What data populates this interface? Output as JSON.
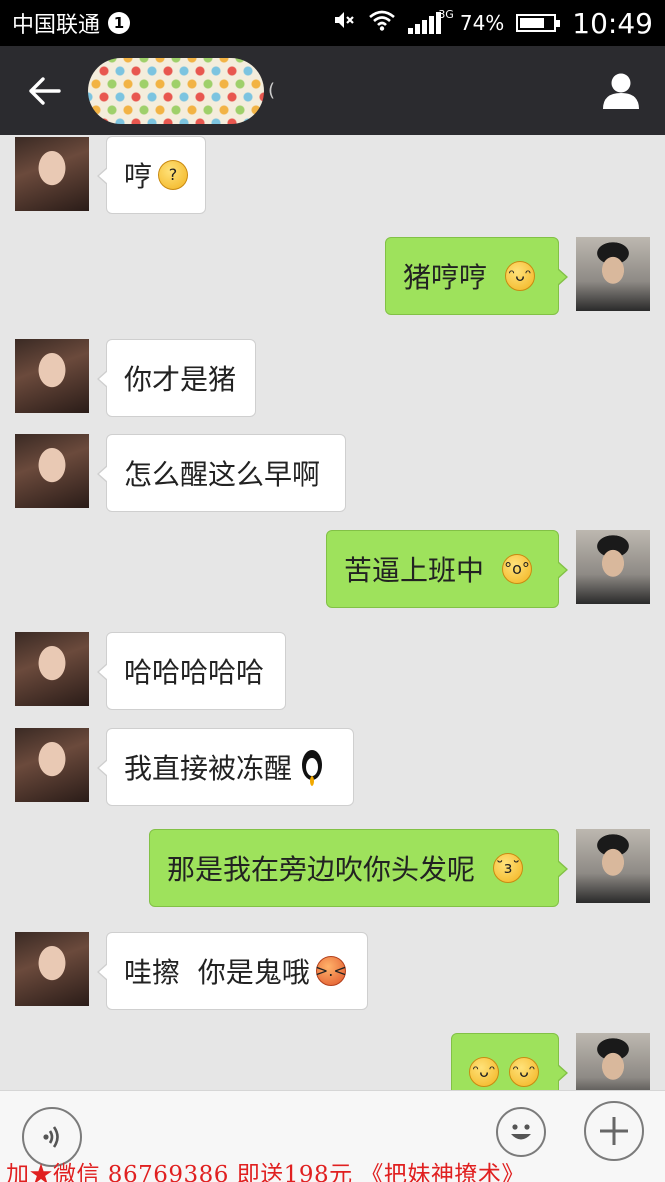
{
  "status_bar": {
    "carrier": "中国联通",
    "notification_count": "1",
    "network_type": "3G",
    "battery": "74%",
    "time": "10:49"
  },
  "title_bar": {
    "back_icon": "arrow-left-icon",
    "contact_name_obscured": true,
    "profile_icon": "person-icon"
  },
  "messages": [
    {
      "side": "in",
      "text": "哼",
      "emoji": [
        "confused"
      ]
    },
    {
      "side": "out",
      "text": "猪哼哼",
      "emoji": [
        "grin"
      ]
    },
    {
      "side": "in",
      "text": "你才是猪",
      "emoji": []
    },
    {
      "side": "in",
      "text": "怎么醒这么早啊",
      "emoji": []
    },
    {
      "side": "out",
      "text": "苦逼上班中",
      "emoji": [
        "shocked"
      ]
    },
    {
      "side": "in",
      "text": "哈哈哈哈哈",
      "emoji": []
    },
    {
      "side": "in",
      "text": "我直接被冻醒",
      "emoji": [
        "qq-penguin"
      ]
    },
    {
      "side": "out",
      "text": "那是我在旁边吹你头发呢",
      "emoji": [
        "kiss"
      ]
    },
    {
      "side": "in",
      "text": "哇擦  你是鬼哦",
      "emoji": [
        "angry"
      ]
    },
    {
      "side": "out",
      "text": "",
      "emoji": [
        "grin",
        "grin"
      ]
    }
  ],
  "input_bar": {
    "voice_icon": "voice-icon",
    "emoji_icon": "smiley-icon",
    "plus_icon": "plus-icon"
  },
  "watermark": "加★微信  86769386  即送198元  《把妹神撩术》",
  "colors": {
    "status_bar": "#000000",
    "title_bar": "#2b2b2f",
    "chat_bg": "#e6e6e6",
    "bubble_out": "#9ee25c",
    "bubble_in": "#ffffff",
    "watermark": "#e02020"
  }
}
